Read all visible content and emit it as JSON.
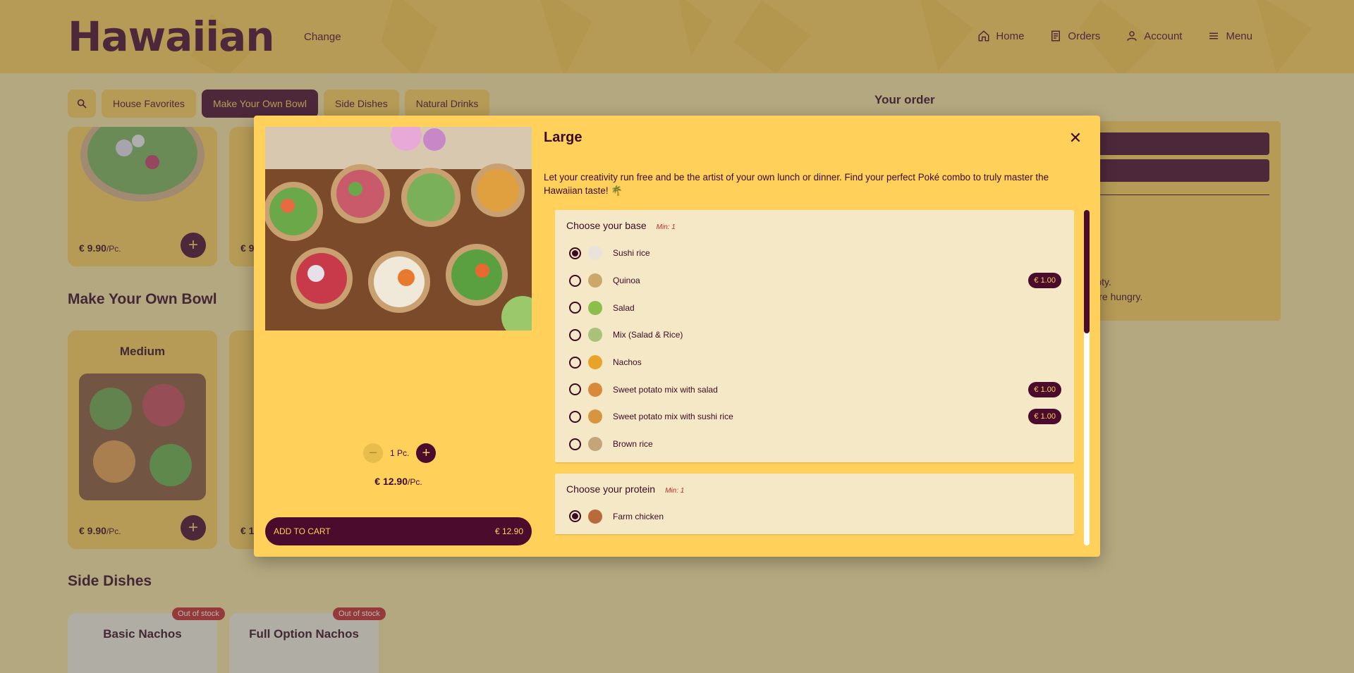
{
  "header": {
    "logo": "Hawaiian",
    "change_label": "Change",
    "nav": [
      {
        "label": "Home",
        "icon": "home-icon"
      },
      {
        "label": "Orders",
        "icon": "receipt-icon"
      },
      {
        "label": "Account",
        "icon": "person-icon"
      },
      {
        "label": "Menu",
        "icon": "hamburger-icon"
      }
    ]
  },
  "categories": [
    "House Favorites",
    "Make Your Own Bowl",
    "Side Dishes",
    "Natural Drinks"
  ],
  "active_category": "Make Your Own Bowl",
  "background": {
    "card_price_top": "€ 9.90",
    "card_price_top_2": "€ 9",
    "section_bowl": "Make Your Own Bowl",
    "card_medium_title": "Medium",
    "card_medium_price": "€ 9.90",
    "card_medium_price_2": "€ 1",
    "per_piece": "/Pc.",
    "section_side": "Side Dishes",
    "side_cards": [
      {
        "title": "Basic Nachos",
        "badge": "Out of stock"
      },
      {
        "title": "Full Option Nachos",
        "badge": "Out of stock"
      }
    ]
  },
  "order": {
    "title": "Your order",
    "empty_line1": "s empty.",
    "empty_line2": "you are hungry."
  },
  "modal": {
    "title": "Large",
    "description": "Let your creativity run free and be the artist of your own lunch or dinner. Find your perfect Poké combo to truly master the Hawaiian taste! 🌴",
    "quantity": "1 Pc.",
    "unit_price": "€ 12.90",
    "per_piece": "/Pc.",
    "add_to_cart": "ADD TO CART",
    "cart_total": "€ 12.90",
    "groups": [
      {
        "name": "Choose your base",
        "min": "Min: 1",
        "options": [
          {
            "name": "Sushi rice",
            "selected": true,
            "price": "",
            "color": "#e8e4dc"
          },
          {
            "name": "Quinoa",
            "selected": false,
            "price": "€ 1.00",
            "color": "#c9a86a"
          },
          {
            "name": "Salad",
            "selected": false,
            "price": "",
            "color": "#8bbf4a"
          },
          {
            "name": "Mix (Salad & Rice)",
            "selected": false,
            "price": "",
            "color": "#a8c27a"
          },
          {
            "name": "Nachos",
            "selected": false,
            "price": "",
            "color": "#e8a428"
          },
          {
            "name": "Sweet potato mix with salad",
            "selected": false,
            "price": "€ 1.00",
            "color": "#d88a3a"
          },
          {
            "name": "Sweet potato mix with sushi rice",
            "selected": false,
            "price": "€ 1.00",
            "color": "#d8953f"
          },
          {
            "name": "Brown rice",
            "selected": false,
            "price": "",
            "color": "#c4a57a"
          }
        ]
      },
      {
        "name": "Choose your protein",
        "min": "Min: 1",
        "options": [
          {
            "name": "Farm chicken",
            "selected": true,
            "price": "",
            "color": "#b86a3a"
          }
        ]
      }
    ]
  },
  "colors": {
    "primary": "#4a0b2c",
    "accent": "#ffd05a",
    "danger": "#c62828"
  }
}
